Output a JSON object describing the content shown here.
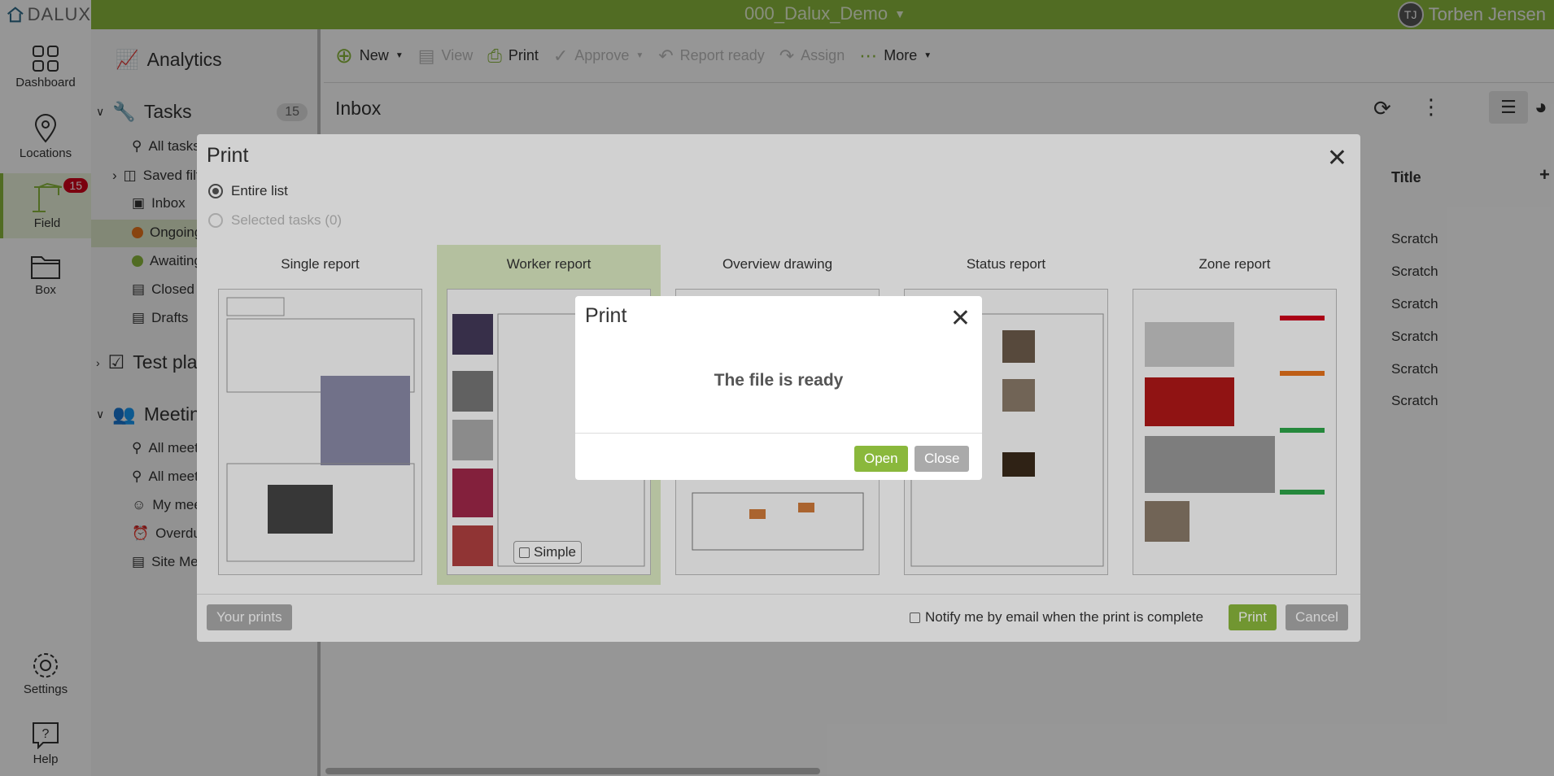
{
  "app": {
    "logo": "DALUX",
    "project": "000_Dalux_Demo",
    "user_initials": "TJ",
    "user_name": "Torben Jensen"
  },
  "rail": {
    "items": [
      {
        "label": "Dashboard",
        "icon": "dashboard-icon"
      },
      {
        "label": "Locations",
        "icon": "location-pin-icon"
      },
      {
        "label": "Field",
        "icon": "crane-icon",
        "badge": "15"
      },
      {
        "label": "Box",
        "icon": "folder-icon"
      },
      {
        "label": "Settings",
        "icon": "gear-icon"
      },
      {
        "label": "Help",
        "icon": "help-icon"
      }
    ]
  },
  "nav": {
    "analytics": "Analytics",
    "tasks": {
      "label": "Tasks",
      "count": "15"
    },
    "task_items": [
      "All tasks",
      "Saved filters",
      "Inbox",
      "Ongoing",
      "Awaiting",
      "Closed",
      "Drafts"
    ],
    "test_plans": "Test plans",
    "meetings": "Meetings",
    "meeting_items": [
      "All meetings",
      "All meetings",
      "My meetings",
      "Overdue",
      "Site Meetings"
    ]
  },
  "toolbar": {
    "new": "New",
    "view": "View",
    "print": "Print",
    "approve": "Approve",
    "report_ready": "Report ready",
    "assign": "Assign",
    "more": "More"
  },
  "inbox": {
    "title": "Inbox",
    "column_title": "Title",
    "rows": [
      "Scratch",
      "Scratch",
      "Scratch",
      "Scratch",
      "Scratch",
      "Scratch"
    ]
  },
  "print_dialog": {
    "title": "Print",
    "option_entire": "Entire list",
    "option_selected": "Selected tasks (0)",
    "reports": [
      "Single report",
      "Worker report",
      "Overview drawing",
      "Status report",
      "Zone report"
    ],
    "simple_label": "Simple",
    "your_prints": "Your prints",
    "notify": "Notify me by email when the print is complete",
    "print_btn": "Print",
    "cancel_btn": "Cancel"
  },
  "ready_modal": {
    "title": "Print",
    "message": "The file is ready",
    "open_btn": "Open",
    "close_btn": "Close"
  },
  "colors": {
    "brand_green": "#8ab83c",
    "badge_red": "#d0021b",
    "ongoing": "#e8731c",
    "awaiting": "#8ab83c"
  }
}
